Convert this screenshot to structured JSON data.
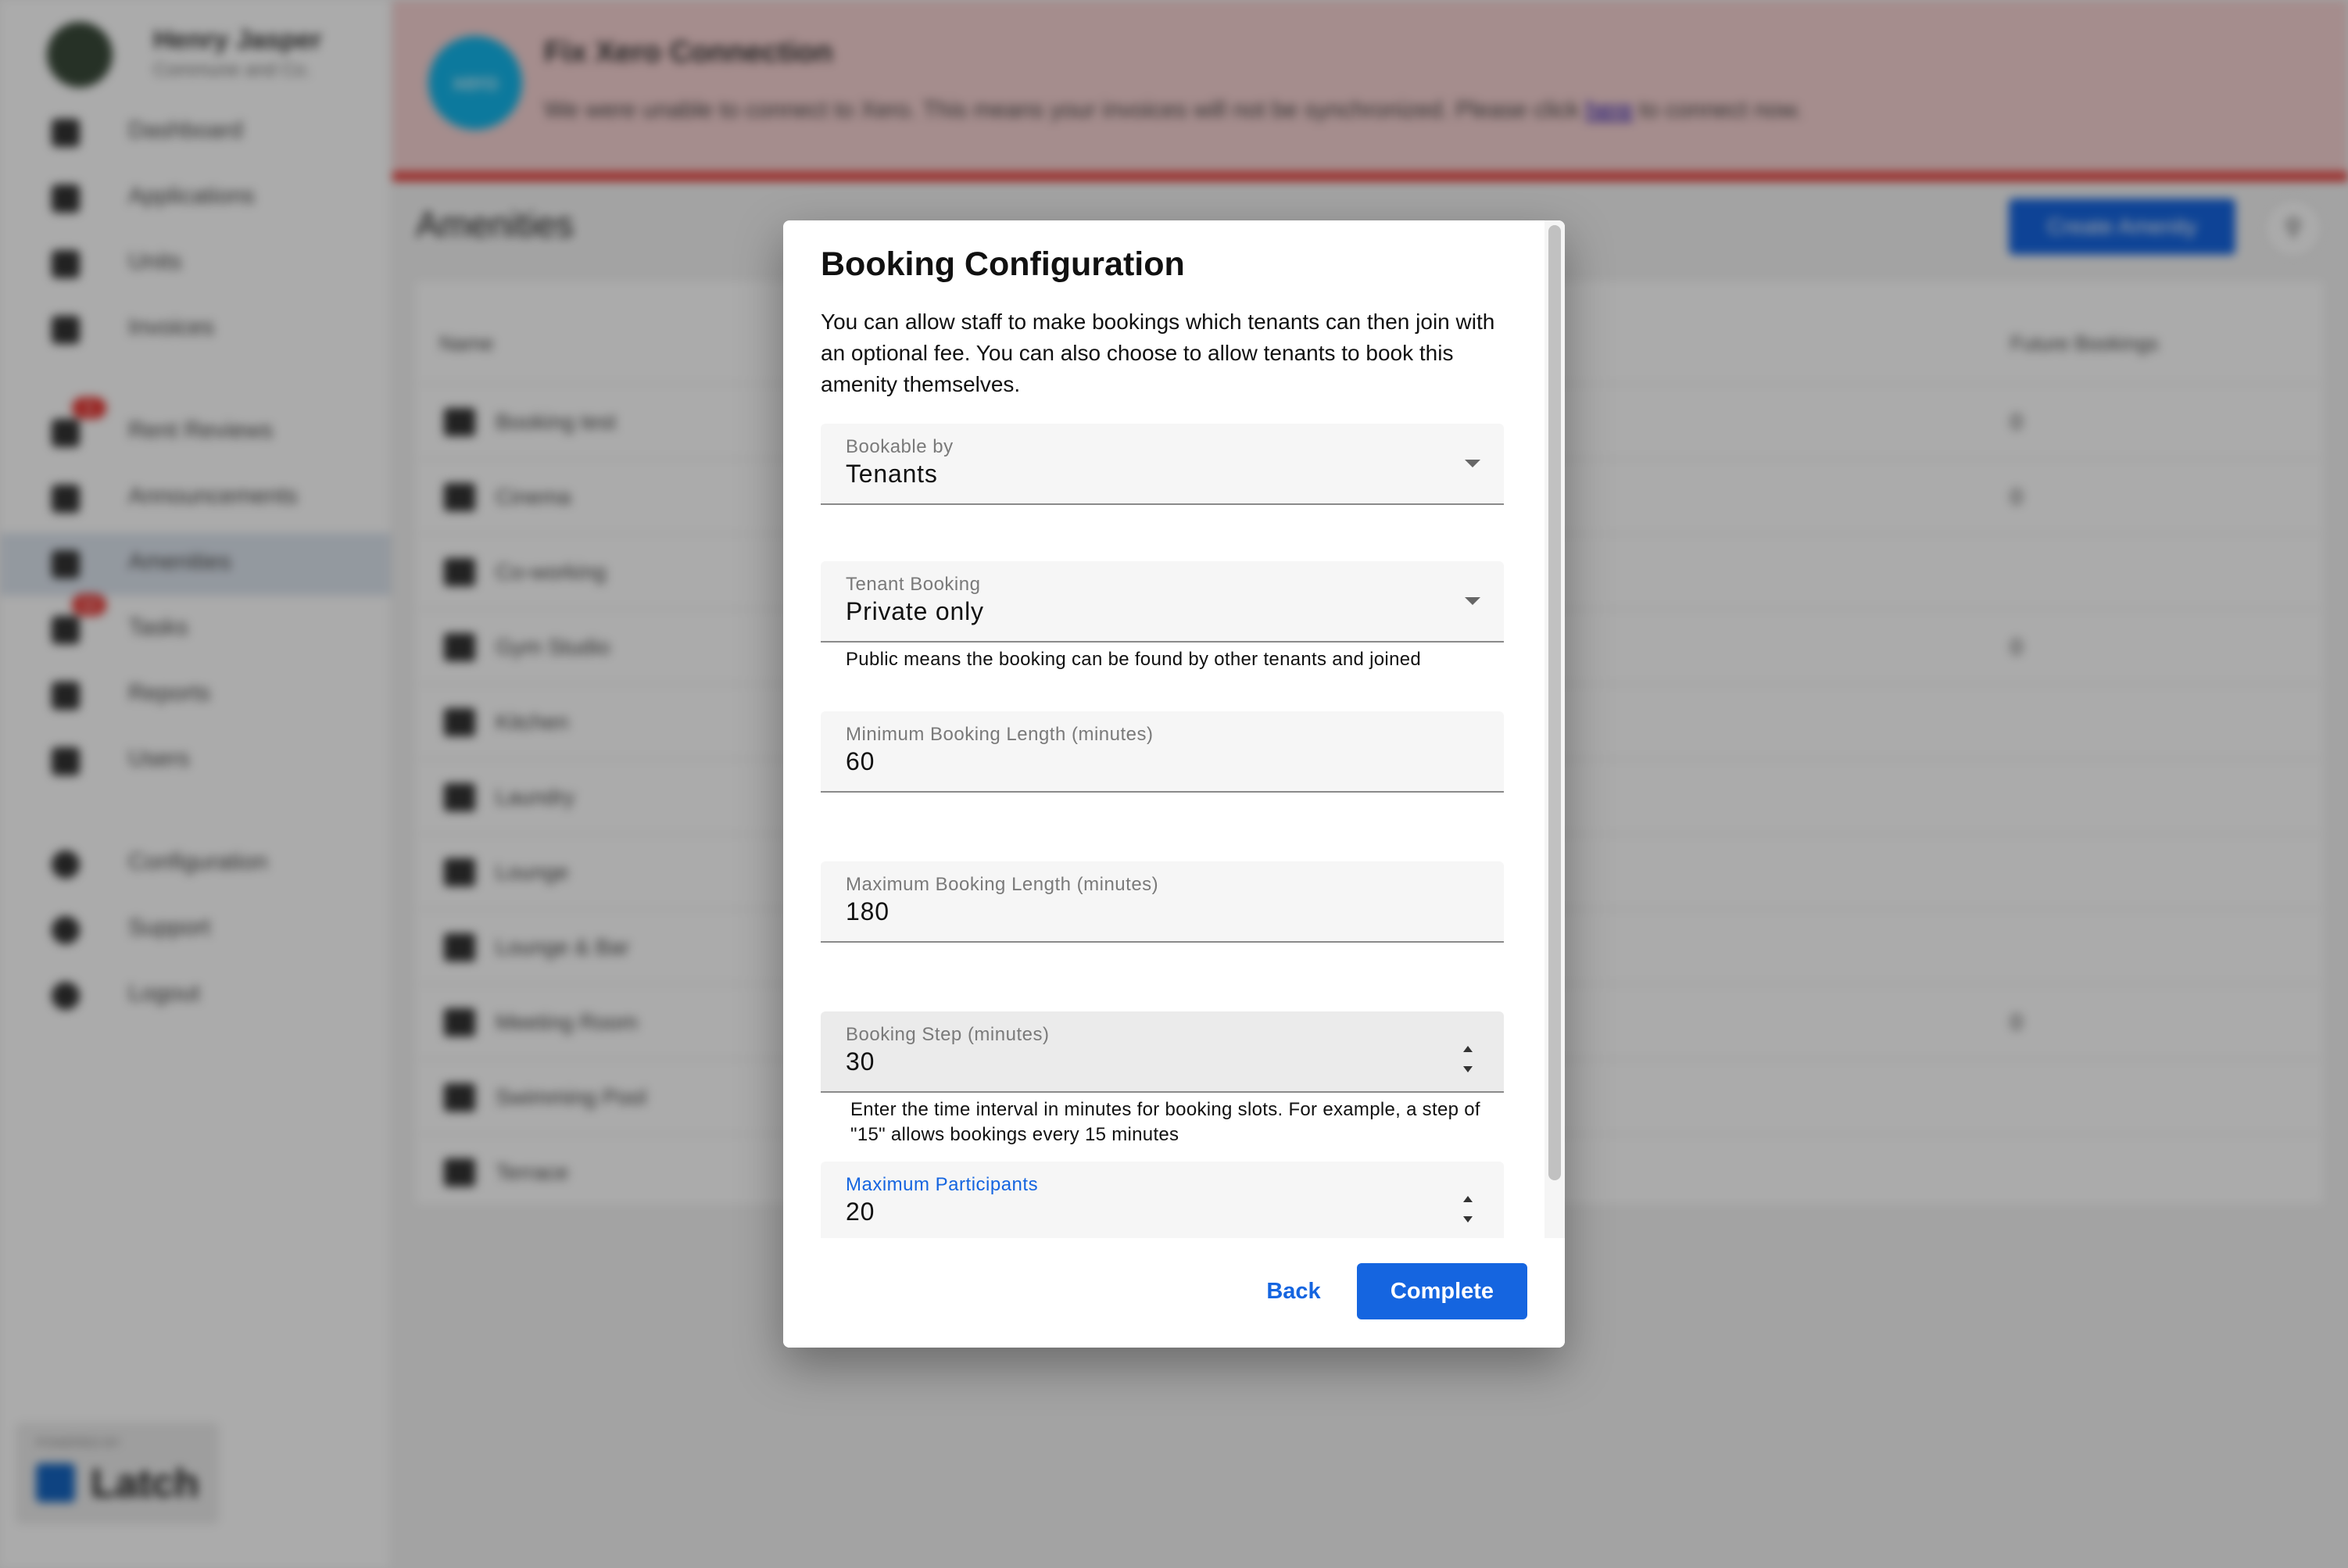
{
  "background": {
    "profile": {
      "name": "Henry Jasper",
      "company": "Commune and Co."
    },
    "sidebar": {
      "items": [
        {
          "label": "Dashboard",
          "icon": "dashboard-icon"
        },
        {
          "label": "Applications",
          "icon": "applications-icon"
        },
        {
          "label": "Units",
          "icon": "units-icon"
        },
        {
          "label": "Invoices",
          "icon": "dollar-icon"
        },
        {
          "label": "Rent Reviews",
          "icon": "rent-reviews-icon",
          "badge": "1"
        },
        {
          "label": "Announcements",
          "icon": "announcements-icon"
        },
        {
          "label": "Amenities",
          "icon": "amenities-icon",
          "active": true
        },
        {
          "label": "Tasks",
          "icon": "tasks-icon",
          "badge": "12"
        },
        {
          "label": "Reports",
          "icon": "reports-icon"
        },
        {
          "label": "Users",
          "icon": "users-icon"
        },
        {
          "label": "Configuration",
          "icon": "gear-icon"
        },
        {
          "label": "Support",
          "icon": "help-icon"
        },
        {
          "label": "Logout",
          "icon": "logout-icon"
        }
      ],
      "powered_by": "POWERED BY",
      "brand": "Latch"
    },
    "banner": {
      "logo_text": "xero",
      "title": "Fix Xero Connection",
      "text_before": "We were unable to connect to Xero. This means your invoices will not be synchronized. Please click ",
      "link": "here",
      "text_after": " to connect now."
    },
    "page": {
      "title": "Amenities",
      "create_button": "Create Amenity",
      "columns": {
        "name": "Name",
        "future_bookings": "Future Bookings"
      },
      "rows": [
        {
          "name": "Booking test",
          "future": "0"
        },
        {
          "name": "Cinema",
          "future": "0"
        },
        {
          "name": "Co-working",
          "future": ""
        },
        {
          "name": "Gym Studio",
          "future": "0"
        },
        {
          "name": "Kitchen",
          "future": ""
        },
        {
          "name": "Laundry",
          "future": ""
        },
        {
          "name": "Lounge",
          "future": ""
        },
        {
          "name": "Lounge & Bar",
          "future": ""
        },
        {
          "name": "Meeting Room",
          "future": "0"
        },
        {
          "name": "Swimming Pool",
          "future": ""
        },
        {
          "name": "Terrace",
          "future": ""
        }
      ]
    }
  },
  "dialog": {
    "title": "Booking Configuration",
    "description": "You can allow staff to make bookings which tenants can then join with an optional fee. You can also choose to allow tenants to book this amenity themselves.",
    "fields": {
      "bookable_by": {
        "label": "Bookable by",
        "value": "Tenants"
      },
      "tenant_booking": {
        "label": "Tenant Booking",
        "value": "Private only",
        "helper": "Public means the booking can be found by other tenants and joined"
      },
      "min_length": {
        "label": "Minimum Booking Length (minutes)",
        "value": "60"
      },
      "max_length": {
        "label": "Maximum Booking Length (minutes)",
        "value": "180"
      },
      "booking_step": {
        "label": "Booking Step (minutes)",
        "value": "30",
        "helper": "Enter the time interval in minutes for booking slots. For example, a step of \"15\" allows bookings every 15 minutes"
      },
      "max_participants": {
        "label": "Maximum Participants",
        "value": "20"
      }
    },
    "actions": {
      "back": "Back",
      "complete": "Complete"
    },
    "colors": {
      "accent": "#1565e0",
      "banner_error": "#e53935"
    }
  }
}
